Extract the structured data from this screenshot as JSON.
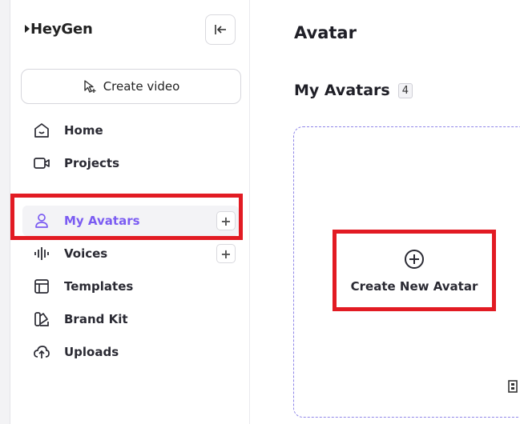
{
  "app": {
    "logo_text": "HeyGen"
  },
  "sidebar": {
    "create_video_label": "Create video",
    "items": [
      {
        "label": "Home",
        "icon": "home-icon"
      },
      {
        "label": "Projects",
        "icon": "video-camera-icon"
      },
      {
        "label": "My Avatars",
        "icon": "user-icon",
        "active": true,
        "has_add": true
      },
      {
        "label": "Voices",
        "icon": "waveform-icon",
        "has_add": true
      },
      {
        "label": "Templates",
        "icon": "template-icon"
      },
      {
        "label": "Brand Kit",
        "icon": "brand-kit-icon"
      },
      {
        "label": "Uploads",
        "icon": "upload-cloud-icon"
      }
    ],
    "add_symbol": "+"
  },
  "main": {
    "title": "Avatar",
    "section_title": "My Avatars",
    "avatar_count": "4",
    "create_avatar_label": "Create New Avatar"
  },
  "colors": {
    "accent": "#7b5cf2",
    "highlight": "#e21b23",
    "dashed_border": "#8f86e8"
  }
}
